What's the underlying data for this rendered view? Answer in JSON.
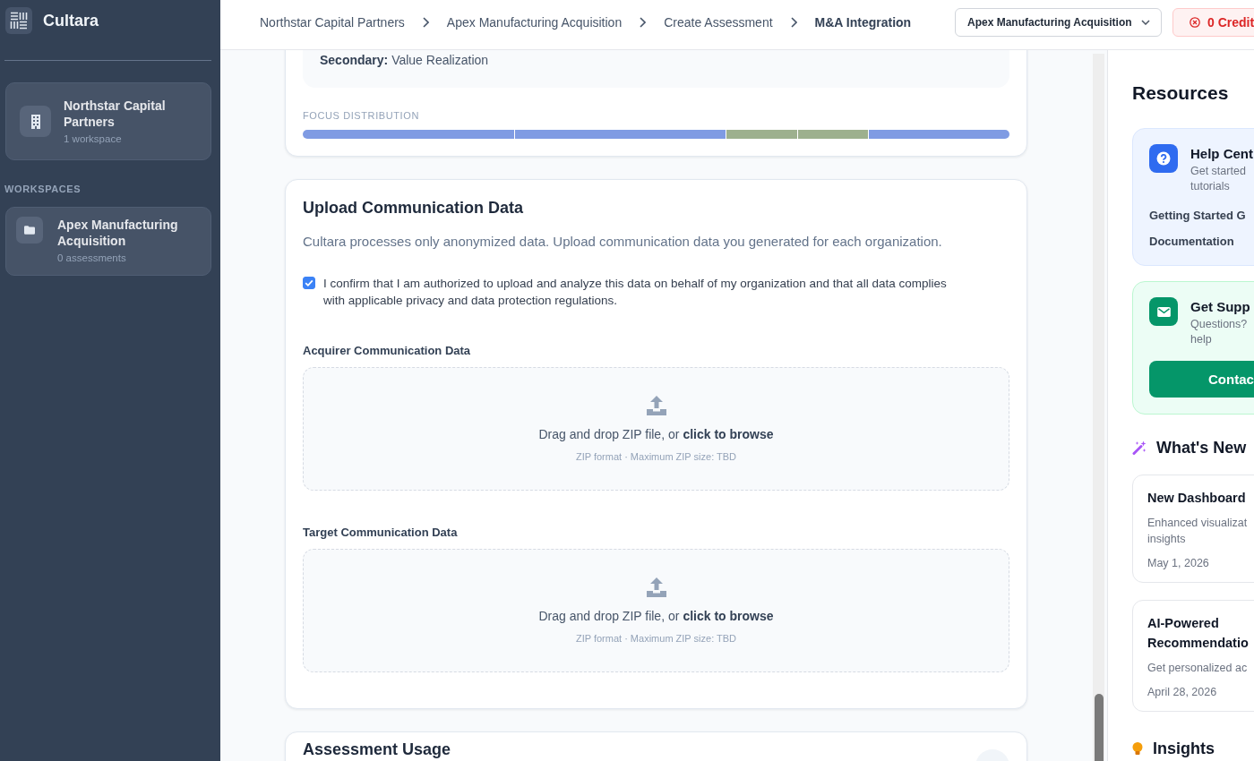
{
  "sidebar": {
    "brand": "Cultara",
    "organization": {
      "name": "Northstar Capital Partners",
      "meta": "1 workspace"
    },
    "workspaces_heading": "WORKSPACES",
    "workspaces": [
      {
        "name": "Apex Manufacturing Acquisition",
        "meta": "0 assessments"
      }
    ]
  },
  "breadcrumbs": [
    {
      "label": "Northstar Capital Partners",
      "current": false
    },
    {
      "label": "Apex Manufacturing Acquisition",
      "current": false
    },
    {
      "label": "Create Assessment",
      "current": false
    },
    {
      "label": "M&A Integration",
      "current": true
    }
  ],
  "workspace_select": {
    "value": "Apex Manufacturing Acquisition"
  },
  "credits_button": {
    "label": "0 Credit"
  },
  "focus_card": {
    "secondary": "**Secondary:** Value Realization",
    "distribution_label": "FOCUS DISTRIBUTION",
    "segments": [
      {
        "color": "#7f9be3"
      },
      {
        "color": "#7f9be3"
      },
      {
        "color": "#9db08e"
      },
      {
        "color": "#9db08e"
      },
      {
        "color": "#7f9be3"
      }
    ]
  },
  "upload_card": {
    "title": "Upload Communication Data",
    "description": "Cultara processes only anonymized data. Upload communication data you generated for each organization.",
    "consent": {
      "checked": true,
      "label": "I confirm that I am authorized to upload and analyze this data on behalf of my organization and that all data complies with applicable privacy and data protection regulations."
    },
    "dropzones": [
      {
        "label": "Acquirer Communication Data",
        "prompt": "Drag and drop ZIP file, or",
        "link": "click to browse",
        "hint": "ZIP format · Maximum ZIP size: TBD"
      },
      {
        "label": "Target Communication Data",
        "prompt": "Drag and drop ZIP file, or",
        "link": "click to browse",
        "hint": "ZIP format · Maximum ZIP size: TBD"
      }
    ]
  },
  "usage_card": {
    "title": "Assessment Usage"
  },
  "resources": {
    "title": "Resources",
    "help_card": {
      "title": "Help Cent",
      "description_lines": [
        "Get started",
        "tutorials"
      ],
      "links": [
        "Getting Started G",
        "Documentation"
      ]
    },
    "support_card": {
      "title": "Get Supp",
      "description_lines": [
        "Questions?",
        "help"
      ],
      "button": "Contac"
    }
  },
  "whats_new": {
    "title": "What's New",
    "items": [
      {
        "title_lines": [
          "New Dashboard"
        ],
        "description_lines": [
          "Enhanced visualizat",
          "insights"
        ],
        "date": "May 1, 2026"
      },
      {
        "title_lines": [
          "AI-Powered",
          "Recommendatio"
        ],
        "description_lines": [
          "Get personalized ac"
        ],
        "date": "April 28, 2026"
      }
    ]
  },
  "insights": {
    "title": "Insights"
  }
}
